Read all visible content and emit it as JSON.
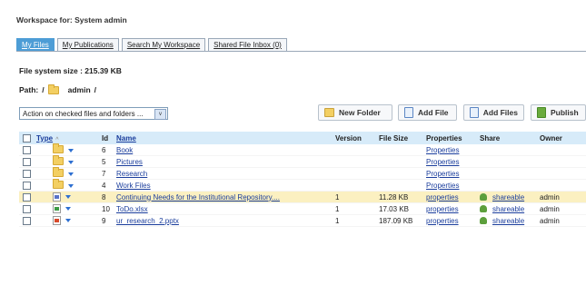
{
  "workspace_title": "Workspace for: System admin",
  "tabs": [
    {
      "label": "My Files",
      "active": true
    },
    {
      "label": "My Publications",
      "active": false
    },
    {
      "label": "Search My Workspace",
      "active": false
    },
    {
      "label": "Shared File Inbox (0)",
      "active": false
    }
  ],
  "file_system_size": "File system size : 215.39 KB",
  "path": {
    "label": "Path:",
    "separator": "/",
    "folder": "admin",
    "end": "/"
  },
  "action_select": {
    "value": "Action on checked files and folders ...",
    "arrow": "v"
  },
  "toolbar": {
    "new_folder": "New Folder",
    "add_file": "Add File",
    "add_files": "Add Files",
    "publish": "Publish"
  },
  "table": {
    "headers": {
      "type": "Type",
      "type_sort": "^",
      "id": "Id",
      "name": "Name",
      "version": "Version",
      "file_size": "File Size",
      "properties": "Properties",
      "share": "Share",
      "owner": "Owner"
    },
    "rows": [
      {
        "kind": "folder",
        "id": "6",
        "name": "Book",
        "version": "",
        "size": "",
        "properties": "Properties",
        "share": "",
        "owner": "",
        "highlight": false
      },
      {
        "kind": "folder",
        "id": "5",
        "name": "Pictures",
        "version": "",
        "size": "",
        "properties": "Properties",
        "share": "",
        "owner": "",
        "highlight": false
      },
      {
        "kind": "folder",
        "id": "7",
        "name": "Research",
        "version": "",
        "size": "",
        "properties": "Properties",
        "share": "",
        "owner": "",
        "highlight": false
      },
      {
        "kind": "folder",
        "id": "4",
        "name": "Work Files",
        "version": "",
        "size": "",
        "properties": "Properties",
        "share": "",
        "owner": "",
        "highlight": false
      },
      {
        "kind": "doc",
        "id": "8",
        "name": "Continuing Needs for the Institutional Repository....",
        "version": "1",
        "size": "11.28 KB",
        "properties": "properties",
        "share": "shareable",
        "owner": "admin",
        "highlight": true
      },
      {
        "kind": "xls",
        "id": "10",
        "name": "ToDo.xlsx",
        "version": "1",
        "size": "17.03 KB",
        "properties": "properties",
        "share": "shareable",
        "owner": "admin",
        "highlight": false
      },
      {
        "kind": "ppt",
        "id": "9",
        "name": "ur_research_2.pptx",
        "version": "1",
        "size": "187.09 KB",
        "properties": "properties",
        "share": "shareable",
        "owner": "admin",
        "highlight": false
      }
    ]
  },
  "colors": {
    "tab_active": "#4d9dd6",
    "header_bg": "#d7ebf9",
    "highlight_row": "#fbf0c1",
    "link": "#1a3d9c"
  }
}
